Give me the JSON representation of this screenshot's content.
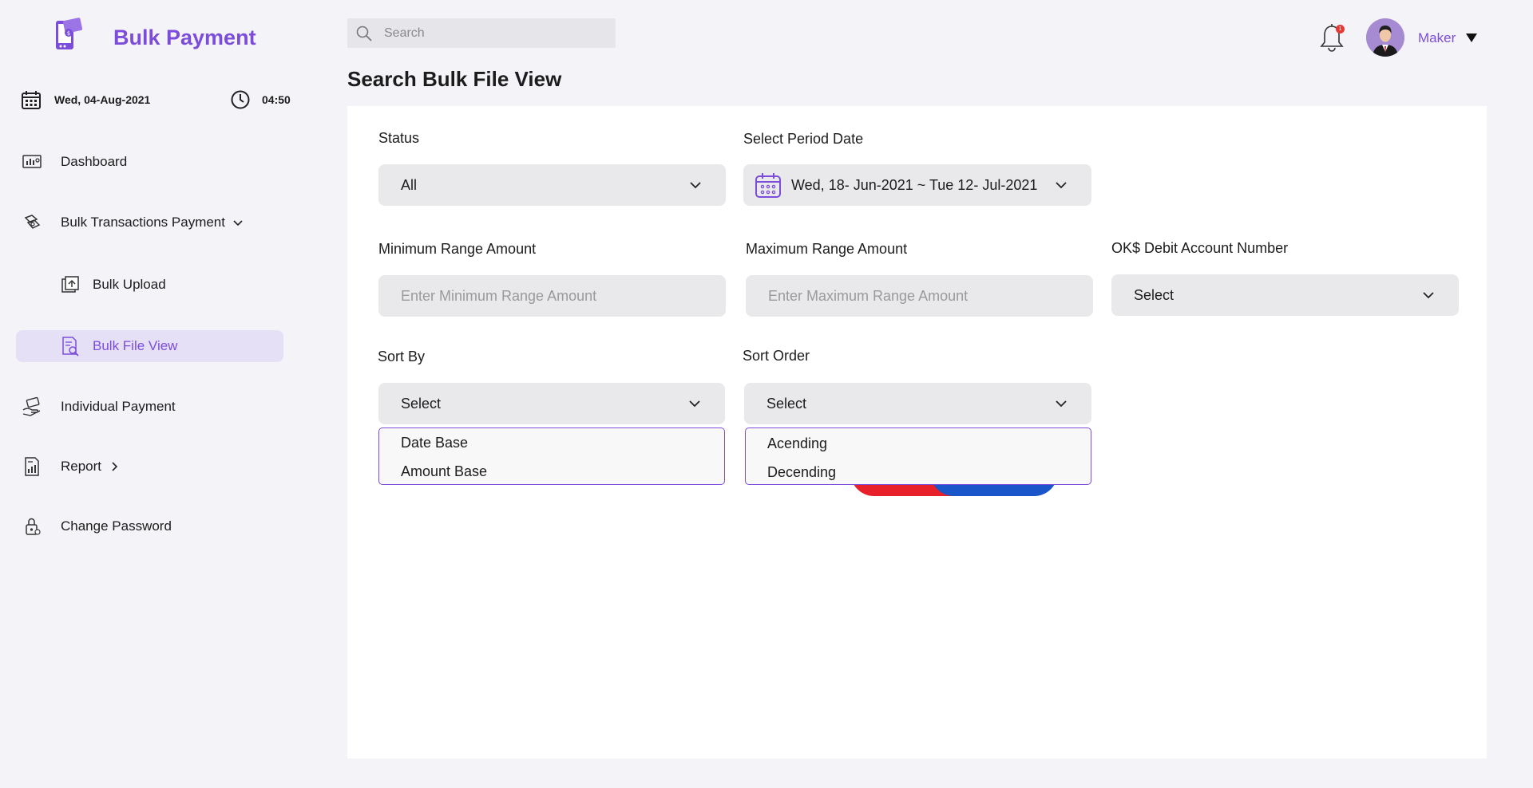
{
  "app": {
    "title": "Bulk Payment"
  },
  "sidebar": {
    "date": "Wed, 04-Aug-2021",
    "time": "04:50",
    "items": [
      {
        "label": "Dashboard",
        "icon": "dashboard-icon"
      },
      {
        "label": "Bulk Transactions Payment",
        "icon": "transactions-icon"
      },
      {
        "label": "Bulk Upload",
        "icon": "upload-icon"
      },
      {
        "label": "Bulk File View",
        "icon": "file-search-icon"
      },
      {
        "label": "Individual Payment",
        "icon": "payment-hand-icon"
      },
      {
        "label": "Report",
        "icon": "report-icon"
      },
      {
        "label": "Change Password",
        "icon": "lock-icon"
      }
    ]
  },
  "header": {
    "search_placeholder": "Search",
    "notification_count": "1",
    "user_name": "Maker"
  },
  "page": {
    "title": "Search Bulk File View"
  },
  "form": {
    "status_label": "Status",
    "status_value": "All",
    "period_label": "Select Period Date",
    "period_value": "Wed, 18- Jun-2021 ~ Tue 12- Jul-2021",
    "min_label": "Minimum Range Amount",
    "min_placeholder": "Enter Minimum Range Amount",
    "max_label": "Maximum Range Amount",
    "max_placeholder": "Enter Maximum Range Amount",
    "account_label": "OK$ Debit Account Number",
    "account_value": "Select",
    "sortby_label": "Sort By",
    "sortby_value": "Select",
    "sortby_options": [
      "Date Base",
      "Amount Base"
    ],
    "sortorder_label": "Sort Order",
    "sortorder_value": "Select",
    "sortorder_options": [
      "Acending",
      "Decending"
    ]
  },
  "colors": {
    "accent": "#7c4ddb",
    "clear": "#e8202a",
    "search": "#1a56c9"
  }
}
